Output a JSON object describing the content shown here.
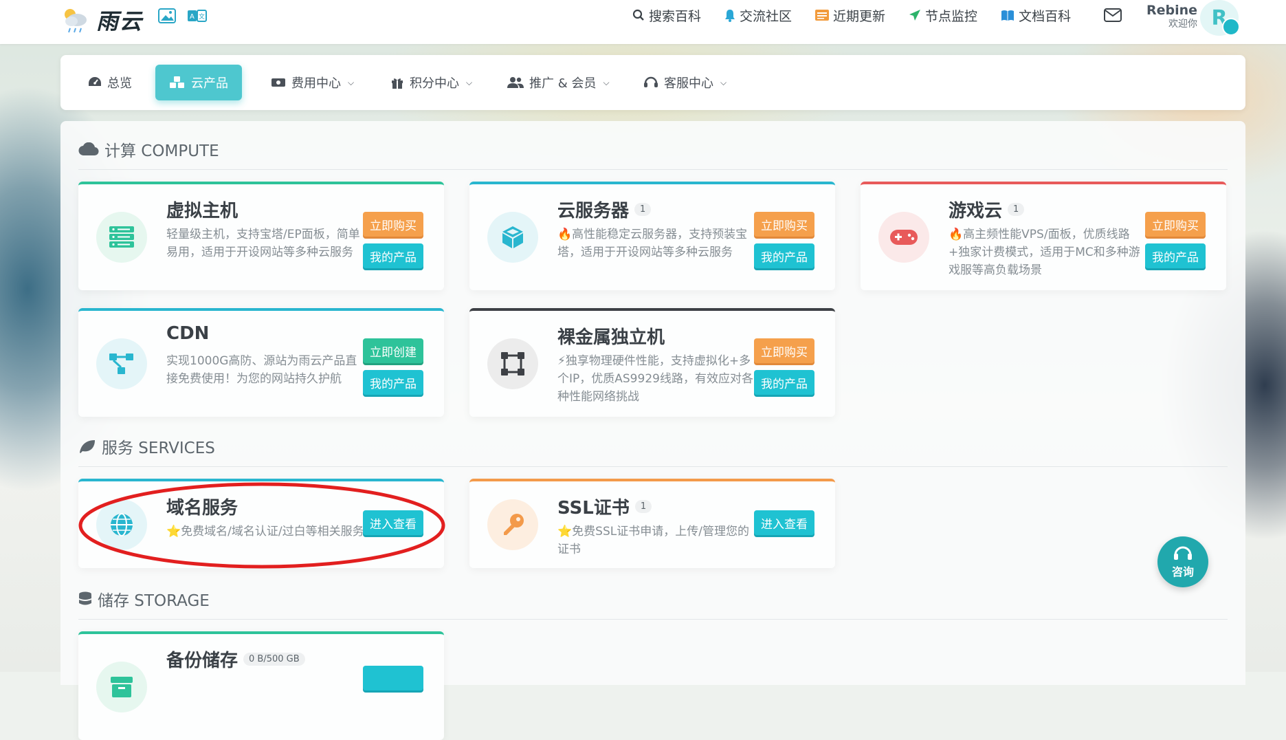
{
  "header": {
    "logo_text": "雨云",
    "nav": [
      {
        "label": "搜索百科",
        "icon": "search-icon"
      },
      {
        "label": "交流社区",
        "icon": "bell-icon"
      },
      {
        "label": "近期更新",
        "icon": "list-icon"
      },
      {
        "label": "节点监控",
        "icon": "send-icon"
      },
      {
        "label": "文档百科",
        "icon": "book-icon"
      }
    ],
    "user": {
      "name": "Rebine",
      "greeting": "欢迎你",
      "avatar_letter": "R"
    }
  },
  "main_nav": [
    {
      "label": "总览",
      "icon": "dashboard-icon",
      "active": false
    },
    {
      "label": "云产品",
      "icon": "cubes-icon",
      "active": true
    },
    {
      "label": "费用中心",
      "icon": "money-icon",
      "active": false,
      "has_dropdown": true
    },
    {
      "label": "积分中心",
      "icon": "gift-icon",
      "active": false,
      "has_dropdown": true
    },
    {
      "label": "推广 & 会员",
      "icon": "users-icon",
      "active": false,
      "has_dropdown": true
    },
    {
      "label": "客服中心",
      "icon": "headset-icon",
      "active": false,
      "has_dropdown": true
    }
  ],
  "sections": {
    "compute": {
      "title": "计算 COMPUTE",
      "cards": [
        {
          "title": "虚拟主机",
          "badge": "",
          "desc": "轻量级主机，支持宝塔/EP面板，简单易用，适用于开设网站等多种云服务",
          "btn1": "立即购买",
          "btn2": "我的产品",
          "accent": "#2ec39a"
        },
        {
          "title": "云服务器",
          "badge": "1",
          "desc": "🔥高性能稳定云服务器，支持预装宝塔，适用于开设网站等多种云服务",
          "btn1": "立即购买",
          "btn2": "我的产品",
          "accent": "#29b6cf"
        },
        {
          "title": "游戏云",
          "badge": "1",
          "desc": "🔥高主频性能VPS/面板，优质线路+独家计费模式，适用于MC和多种游戏服等高负载场景",
          "btn1": "立即购买",
          "btn2": "我的产品",
          "accent": "#e85a5a"
        },
        {
          "title": "CDN",
          "badge": "",
          "desc": "实现1000G高防、源站为雨云产品直接免费使用！为您的网站持久护航",
          "btn1": "立即创建",
          "btn2": "我的产品",
          "accent": "#29b6cf"
        },
        {
          "title": "裸金属独立机",
          "badge": "",
          "desc": "⚡独享物理硬件性能，支持虚拟化+多个IP，优质AS9929线路，有效应对各种性能网络挑战",
          "btn1": "立即购买",
          "btn2": "我的产品",
          "accent": "#3d4045"
        }
      ]
    },
    "services": {
      "title": "服务 SERVICES",
      "cards": [
        {
          "title": "域名服务",
          "badge": "",
          "desc": "⭐免费域名/域名认证/过白等相关服务",
          "btn1": "进入查看",
          "accent": "#29b6cf"
        },
        {
          "title": "SSL证书",
          "badge": "1",
          "desc": "⭐免费SSL证书申请，上传/管理您的证书",
          "btn1": "进入查看",
          "accent": "#f39a4a"
        }
      ]
    },
    "storage": {
      "title": "储存 STORAGE",
      "cards": [
        {
          "title": "备份储存",
          "badge": "0 B/500 GB",
          "accent": "#2ec39a"
        }
      ]
    }
  },
  "consult": {
    "label": "咨询"
  }
}
